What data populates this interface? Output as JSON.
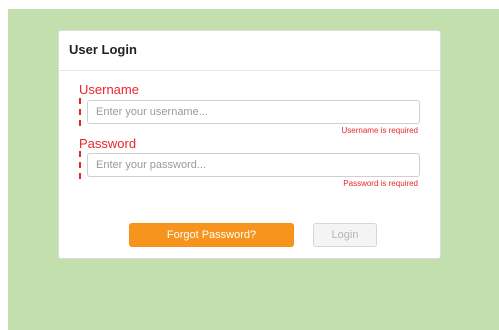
{
  "login_card": {
    "title": "User Login"
  },
  "username": {
    "label": "Username",
    "placeholder": "Enter your username...",
    "value": "",
    "error": "Username is required"
  },
  "password": {
    "label": "Password",
    "placeholder": "Enter your password...",
    "value": "",
    "error": "Password is required"
  },
  "actions": {
    "forgot_label": "Forgot Password?",
    "login_label": "Login"
  },
  "colors": {
    "background": "#c4dfae",
    "error": "#e8262d",
    "forgot_button": "#f7941d",
    "login_button_disabled": "#f4f4f4"
  }
}
